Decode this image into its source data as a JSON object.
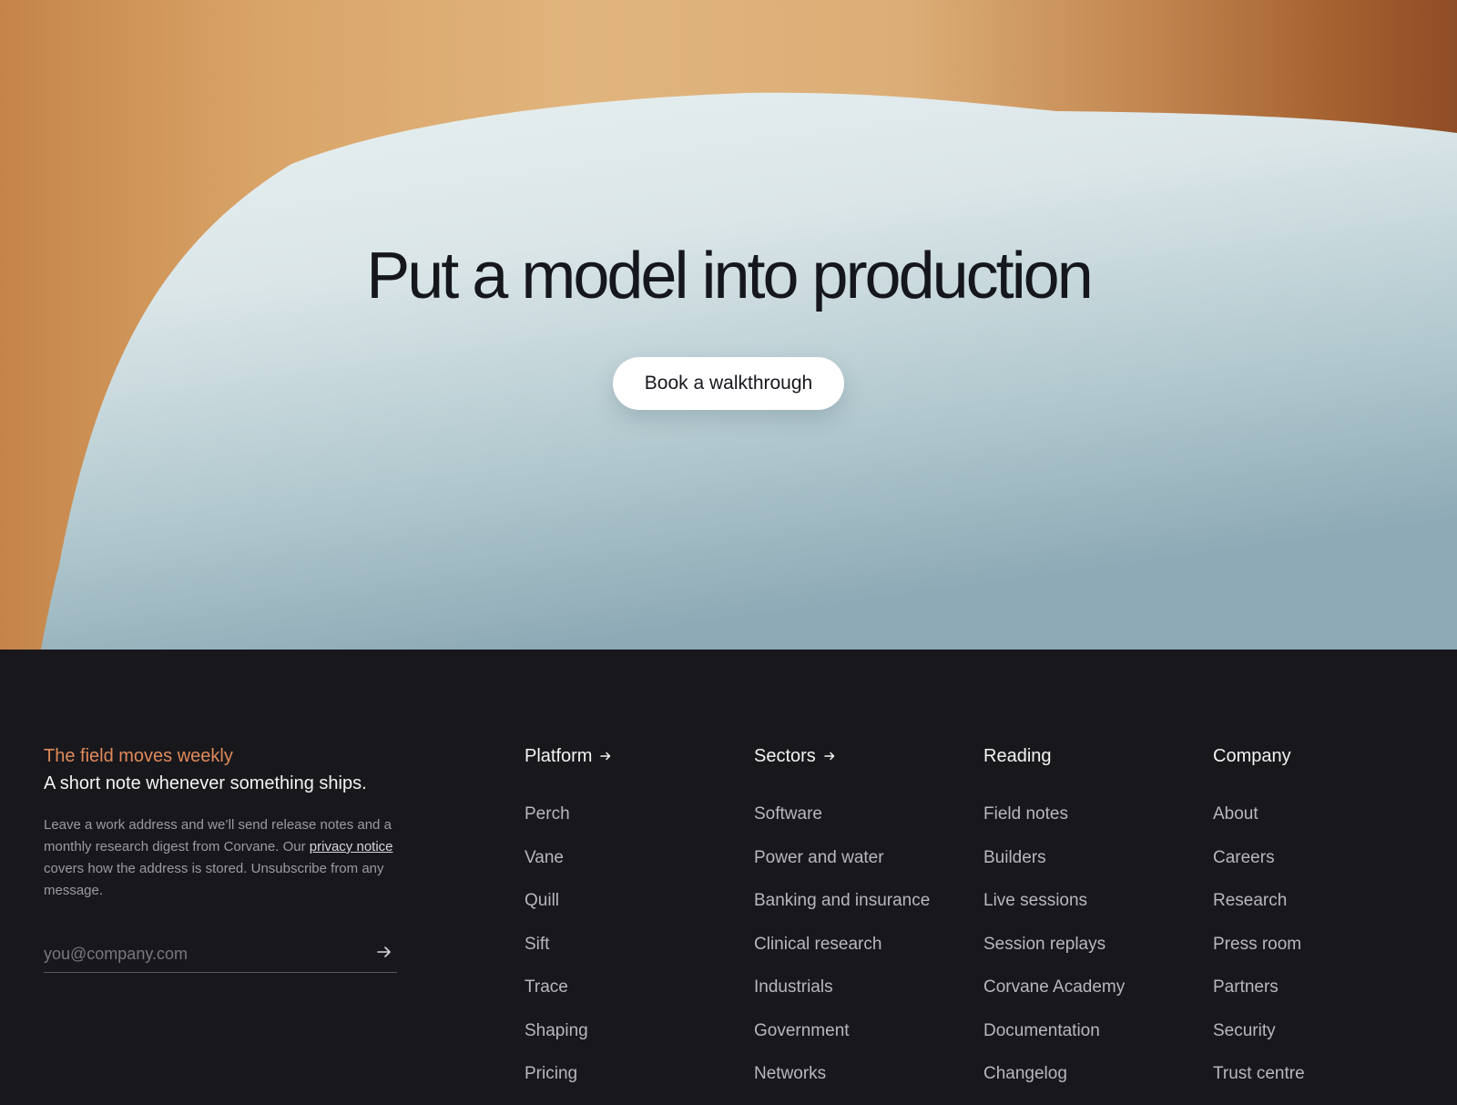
{
  "hero": {
    "title": "Put a model into production",
    "cta_label": "Book a walkthrough"
  },
  "newsletter": {
    "kicker": "The field moves weekly",
    "heading": "A short note whenever something ships.",
    "body_prefix": "Leave a work address and we’ll send release notes and a monthly research digest from Corvane. Our ",
    "privacy_link": "privacy notice",
    "body_suffix": " covers how the address is stored. Unsubscribe from any message.",
    "email_placeholder": "you@company.com",
    "submit_icon": "arrow-right-icon"
  },
  "footer_columns": [
    {
      "heading": "Platform",
      "has_arrow": true,
      "items": [
        "Perch",
        "Vane",
        "Quill",
        "Sift",
        "Trace",
        "Shaping",
        "Pricing"
      ]
    },
    {
      "heading": "Sectors",
      "has_arrow": true,
      "items": [
        "Software",
        "Power and water",
        "Banking and insurance",
        "Clinical research",
        "Industrials",
        "Government",
        "Networks"
      ]
    },
    {
      "heading": "Reading",
      "has_arrow": false,
      "items": [
        "Field notes",
        "Builders",
        "Live sessions",
        "Session replays",
        "Corvane Academy",
        "Documentation",
        "Changelog"
      ]
    },
    {
      "heading": "Company",
      "has_arrow": false,
      "items": [
        "About",
        "Careers",
        "Research",
        "Press room",
        "Partners",
        "Security",
        "Trust centre"
      ]
    }
  ],
  "colors": {
    "footer_bg": "#18181c",
    "accent": "#e08a5a",
    "hero_warm": "#dcae77",
    "hero_cool": "#dde8ea"
  }
}
